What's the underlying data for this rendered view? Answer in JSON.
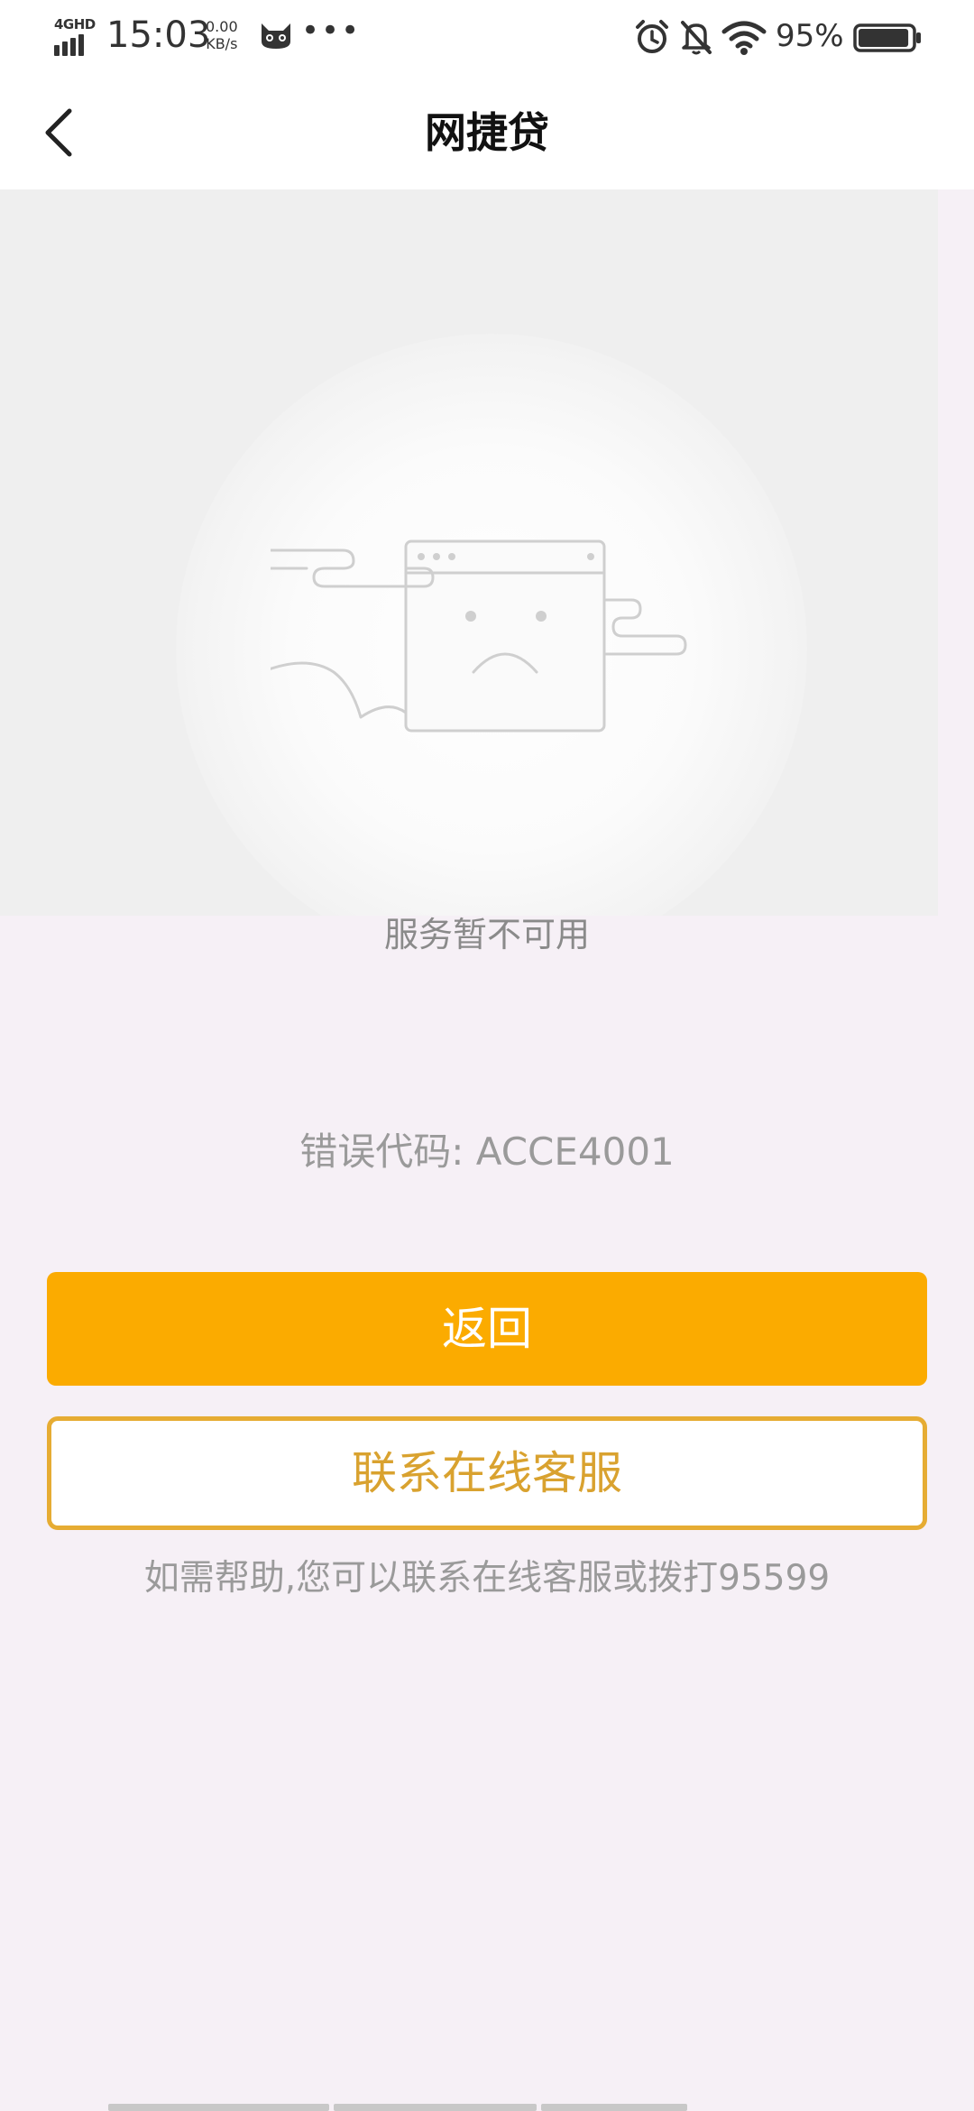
{
  "status_bar": {
    "network": "4GHD",
    "time": "15:03",
    "speed_value": "0.00",
    "speed_unit": "KB/s",
    "more": "•••",
    "battery_percent": "95%",
    "battery_level": 0.95,
    "icons": [
      "signal-icon",
      "cat-app-icon",
      "alarm-icon",
      "bell-mute-icon",
      "wifi-icon",
      "battery-icon"
    ]
  },
  "nav": {
    "back_icon": "chevron-left-icon",
    "title": "网捷贷"
  },
  "illustration": {
    "icon": "broken-window-sad-face-icon"
  },
  "error": {
    "message": "服务暂不可用",
    "code": "错误代码: ACCE4001"
  },
  "buttons": {
    "back_label": "返回",
    "service_label": "联系在线客服"
  },
  "help_text": "如需帮助,您可以联系在线客服或拨打95599",
  "colors": {
    "primary": "#fbab00",
    "outline": "#e6ac33",
    "page_bg": "#f6f0f6"
  }
}
